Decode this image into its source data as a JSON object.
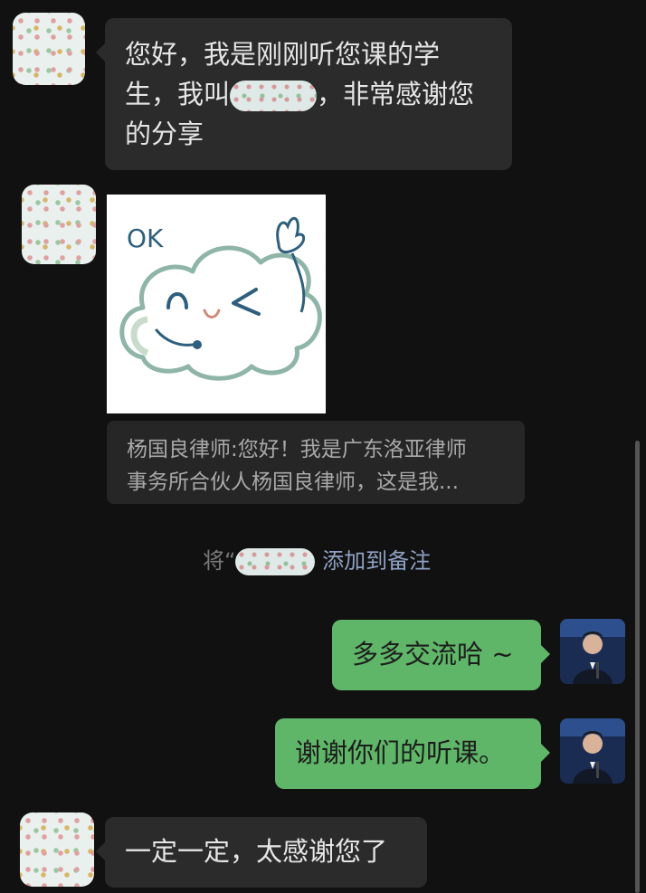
{
  "messages": {
    "m1": {
      "line1": "您好，我是刚刚听您课的学",
      "line2a": "生，我叫",
      "line2b": "，非常感谢您",
      "line3": "的分享"
    },
    "sticker": {
      "text": "OK"
    },
    "quote": {
      "line1": "杨国良律师:您好！我是广东洛亚律师",
      "line2": "事务所合伙人杨国良律师，这是我..."
    },
    "system": {
      "prefix": "将“",
      "suffix": "添加到备注"
    },
    "m_self1": "多多交流哈 ~",
    "m_self2": "谢谢你们的听课。",
    "m_last": "一定一定，太感谢您了"
  },
  "colors": {
    "background": "#111111",
    "incoming_bubble": "#2b2b2b",
    "outgoing_bubble": "#5fb668",
    "system_highlight": "#8fa1c4"
  }
}
